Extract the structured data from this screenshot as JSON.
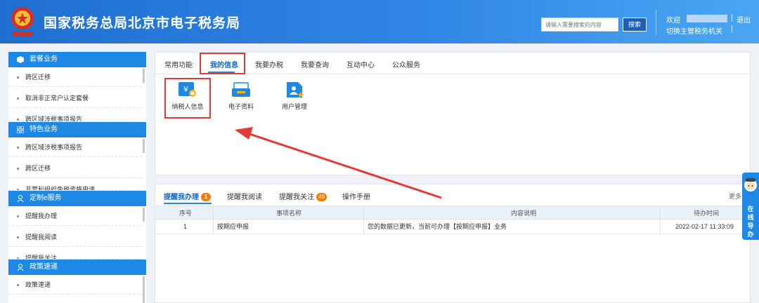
{
  "header": {
    "title": "国家税务总局北京市电子税务局",
    "search_placeholder": "请输入需要搜索的内容",
    "search_button": "搜索",
    "welcome": "欢迎",
    "logout": "退出",
    "switch_org": "切换主管税务机关",
    "separator": "|",
    "logo_icon": "tax-emblem-icon"
  },
  "sidebar": {
    "sections": [
      {
        "title": "套餐业务",
        "icon": "package-icon",
        "items": [
          "跨区迁移",
          "取消非正常户认定套餐",
          "跨区域涉税事项报告"
        ]
      },
      {
        "title": "特色业务",
        "icon": "grid-icon",
        "items": [
          "跨区域涉税事项报告",
          "跨区迁移",
          "非营利组织免税资格申请"
        ]
      },
      {
        "title": "定制e服务",
        "icon": "user-icon",
        "items": [
          "提醒我办理",
          "提醒我阅读",
          "提醒我关注"
        ]
      },
      {
        "title": "政策速递",
        "icon": "user-icon",
        "items": [
          "政策速递"
        ]
      }
    ]
  },
  "main_tabs": [
    "常用功能",
    "我的信息",
    "我要办税",
    "我要查询",
    "互动中心",
    "公众服务"
  ],
  "active_tab": "我的信息",
  "functions": [
    {
      "label": "纳税人信息",
      "icon": "taxpayer-info-icon"
    },
    {
      "label": "电子资料",
      "icon": "electronic-docs-icon"
    },
    {
      "label": "用户管理",
      "icon": "user-management-icon"
    }
  ],
  "reminders": {
    "tabs": [
      {
        "label": "提醒我办理",
        "badge": "1"
      },
      {
        "label": "提醒我阅读",
        "badge": ""
      },
      {
        "label": "提醒我关注",
        "badge": "49"
      },
      {
        "label": "操作手册",
        "badge": ""
      }
    ],
    "more": "更多",
    "columns": [
      "序号",
      "事项名称",
      "内容说明",
      "待办时间"
    ],
    "rows": [
      {
        "no": "1",
        "name": "按期应申报",
        "desc": "您的数据已更新，当前可办理【按期应申报】业务",
        "time": "2022-02-17 11:33:09"
      }
    ]
  },
  "float_helper": {
    "label": "在线导办",
    "icon": "assistant-avatar-icon"
  },
  "colors": {
    "header_blue": "#1f6fd0",
    "accent": "#1e88e5",
    "highlight_red": "#e53935",
    "badge_orange": "#f57c00"
  }
}
